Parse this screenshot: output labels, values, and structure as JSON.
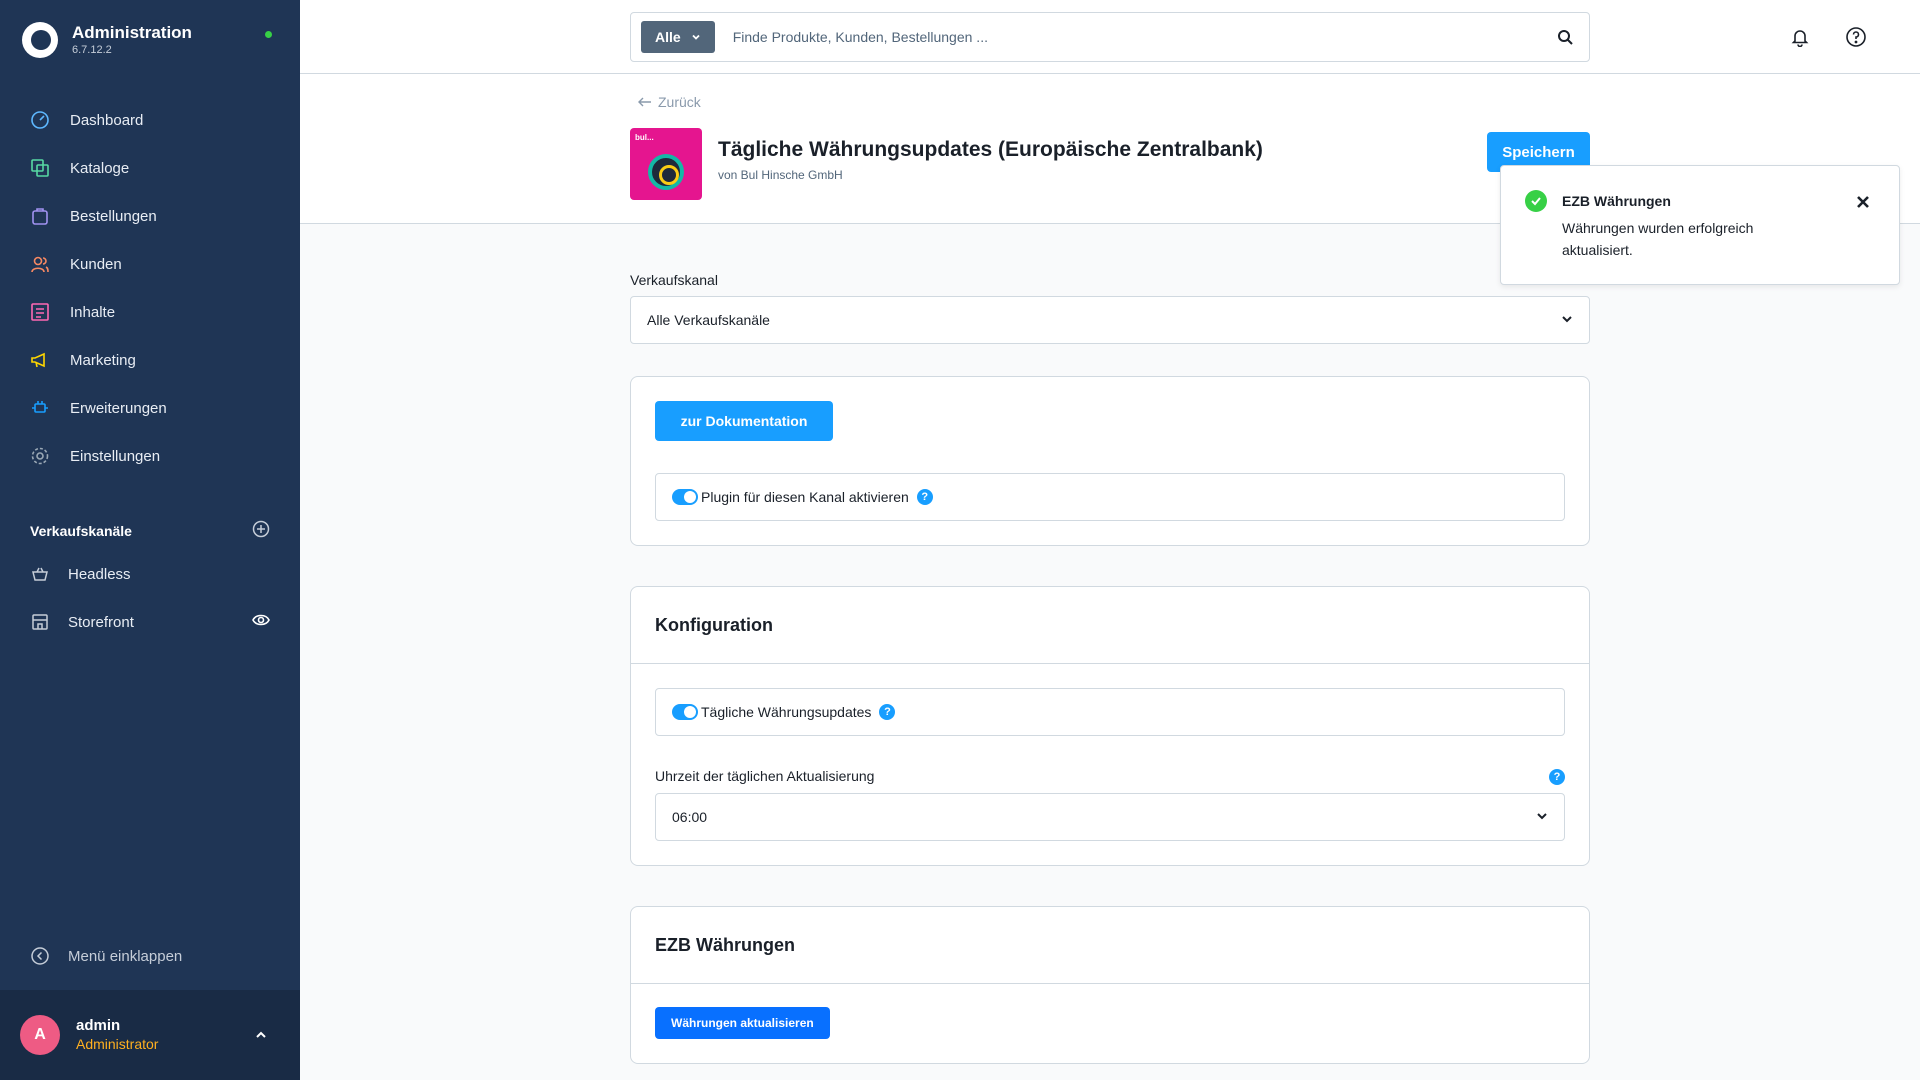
{
  "brand": {
    "title": "Administration",
    "version": "6.7.12.2"
  },
  "nav": [
    {
      "label": "Dashboard",
      "icon": "dashboard-icon",
      "color": "#5eb8ff"
    },
    {
      "label": "Kataloge",
      "icon": "catalog-icon",
      "color": "#57d9a3"
    },
    {
      "label": "Bestellungen",
      "icon": "orders-icon",
      "color": "#a092f0"
    },
    {
      "label": "Kunden",
      "icon": "customers-icon",
      "color": "#f88962"
    },
    {
      "label": "Inhalte",
      "icon": "content-icon",
      "color": "#ff68b4"
    },
    {
      "label": "Marketing",
      "icon": "marketing-icon",
      "color": "#ffd700"
    },
    {
      "label": "Erweiterungen",
      "icon": "extensions-icon",
      "color": "#189eff"
    },
    {
      "label": "Einstellungen",
      "icon": "settings-icon",
      "color": "#9aa8b5"
    }
  ],
  "sales_channels": {
    "heading": "Verkaufskanäle",
    "items": [
      {
        "label": "Headless",
        "icon": "basket-icon"
      },
      {
        "label": "Storefront",
        "icon": "storefront-icon"
      }
    ]
  },
  "collapse_label": "Menü einklappen",
  "user": {
    "initial": "A",
    "name": "admin",
    "role": "Administrator"
  },
  "search": {
    "type_label": "Alle",
    "placeholder": "Finde Produkte, Kunden, Bestellungen ..."
  },
  "header": {
    "back_label": "Zurück",
    "plugin_title": "Tägliche Währungsupdates (Europäische Zentralbank)",
    "vendor": "von Bul Hinsche GmbH",
    "logo_text": "bul...",
    "save_label": "Speichern"
  },
  "toast": {
    "title": "EZB Währungen",
    "message": "Währungen wurden erfolgreich aktualisiert."
  },
  "sales_channel_field": {
    "label": "Verkaufskanal",
    "value": "Alle Verkaufskanäle"
  },
  "card_plugin": {
    "doc_button": "zur Dokumentation",
    "toggle_label": "Plugin für diesen Kanal aktivieren",
    "toggle_on": true
  },
  "card_config": {
    "title": "Konfiguration",
    "toggle_label": "Tägliche Währungsupdates",
    "toggle_on": true,
    "time_label": "Uhrzeit der täglichen Aktualisierung",
    "time_value": "06:00"
  },
  "card_ecb": {
    "title": "EZB Währungen",
    "button": "Währungen aktualisieren"
  },
  "colors": {
    "sidebar": "#1f3555",
    "primary": "#189eff",
    "success": "#37d046",
    "role": "#ffb020"
  }
}
